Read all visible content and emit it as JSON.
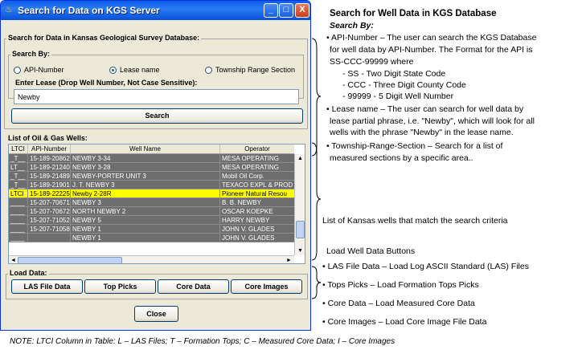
{
  "window": {
    "title": "Search for Data on KGS Server",
    "minimize": "_",
    "maximize": "□",
    "close": "X"
  },
  "search_group": {
    "title": "Search for Data in Kansas Geological Survey Database:",
    "search_by_title": "Search By:",
    "options": [
      "API-Number",
      "Lease name",
      "Township Range Section"
    ],
    "selected_option": "Lease name",
    "lease_group_title": "Enter Lease (Drop Well Number, Not Case Sensitive):",
    "lease_value": "Newby",
    "search_button": "Search"
  },
  "wells_group": {
    "title": "List of Oil & Gas Wells:",
    "columns": [
      "LTCI",
      "API-Number",
      "Well Name",
      "Operator"
    ],
    "rows": [
      {
        "ltci": "_T__",
        "api": "15-189-20862",
        "name": "NEWBY 3-34",
        "operator": "MESA OPERATING"
      },
      {
        "ltci": "LT__",
        "api": "15-189-21240",
        "name": "NEWBY 3-28",
        "operator": "MESA OPERATING"
      },
      {
        "ltci": "_T__",
        "api": "15-189-21489",
        "name": "NEWBY-PORTER UNIT 3",
        "operator": "Mobil Oil Corp."
      },
      {
        "ltci": "_T__",
        "api": "15-189-21901",
        "name": "J. T. NEWBY 3",
        "operator": "TEXACO EXPL & PROD"
      },
      {
        "ltci": "LTCI",
        "api": "15-189-22225",
        "name": "Newby 2-28R",
        "operator": "Pioneer Natural Resou"
      },
      {
        "ltci": "____",
        "api": "15-207-70671",
        "name": "NEWBY 3",
        "operator": "B. B. NEWBY"
      },
      {
        "ltci": "____",
        "api": "15-207-70672",
        "name": "NORTH NEWBY 2",
        "operator": "OSCAR KOEPKE"
      },
      {
        "ltci": "____",
        "api": "15-207-71052",
        "name": "NEWBY 5",
        "operator": "HARRY NEWBY"
      },
      {
        "ltci": "____",
        "api": "15-207-71058",
        "name": "NEWBY 1",
        "operator": "JOHN V. GLADES"
      },
      {
        "ltci": "____",
        "api": "",
        "name": "NEWBY 1",
        "operator": "JOHN V. GLADES"
      }
    ],
    "selected_row": 4
  },
  "load_group": {
    "title": "Load Data:",
    "buttons": [
      "LAS File Data",
      "Top Picks",
      "Core Data",
      "Core Images"
    ]
  },
  "close_button": "Close",
  "annotations": {
    "heading": "Search for Well Data in KGS Database",
    "search_by": "Search By:",
    "api_lines": [
      "• API-Number – The user can search the KGS Database",
      "for well data by API-Number.  The Format for the API is",
      "SS-CCC-99999 where",
      "- SS -  Two Digit State Code",
      "- CCC - Three Digit County Code",
      "- 99999 - 5 Digit Well Number"
    ],
    "lease_lines": [
      "• Lease name – The user can search for well data by",
      "lease partial phrase, i.e. \"Newby\", which will look for all",
      "wells with the phrase \"Newby\" in the lease name."
    ],
    "trs_lines": [
      "• Township-Range-Section – Search for a list of",
      "measured sections by a specific area.."
    ],
    "list_note": "List of Kansas wells that match the search criteria",
    "load_heading": "Load Well Data Buttons",
    "load_lines": [
      "• LAS File Data – Load Log ASCII Standard (LAS) Files",
      "• Tops Picks – Load Formation Tops Picks",
      "• Core Data – Load Measured Core Data",
      "• Core Images – Load Core Image File Data"
    ],
    "note": "NOTE: LTCI Column in Table: L – LAS Files; T – Formation Tops; C – Measured Core Data; I – Core Images"
  }
}
